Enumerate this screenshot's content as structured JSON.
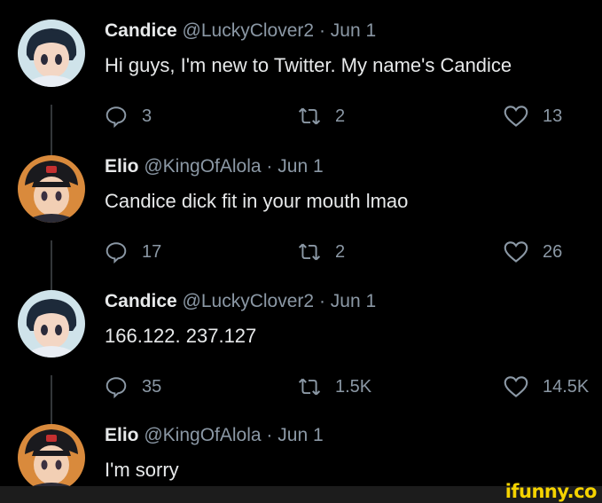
{
  "tweets": [
    {
      "name": "Candice",
      "handle": "@LuckyClover2",
      "sep": "·",
      "date": "Jun 1",
      "text": "Hi guys, I'm new to Twitter. My name's Candice",
      "replies": "3",
      "retweets": "2",
      "likes": "13"
    },
    {
      "name": "Elio",
      "handle": "@KingOfAlola",
      "sep": "·",
      "date": "Jun 1",
      "text": "Candice dick fit in your mouth lmao",
      "replies": "17",
      "retweets": "2",
      "likes": "26"
    },
    {
      "name": "Candice",
      "handle": "@LuckyClover2",
      "sep": "·",
      "date": "Jun 1",
      "text": "166.122. 237.127",
      "replies": "35",
      "retweets": "1.5K",
      "likes": "14.5K"
    },
    {
      "name": "Elio",
      "handle": "@KingOfAlola",
      "sep": "·",
      "date": "Jun 1",
      "text": "I'm sorry"
    }
  ],
  "watermark": {
    "text": "ifunny.co",
    "color": "#f5d300"
  },
  "colors": {
    "background": "#000000",
    "text": "#e7e9ea",
    "muted": "#8b98a5",
    "thread_line": "#333639"
  },
  "icons": {
    "reply": "reply-icon",
    "retweet": "retweet-icon",
    "like": "heart-icon"
  }
}
